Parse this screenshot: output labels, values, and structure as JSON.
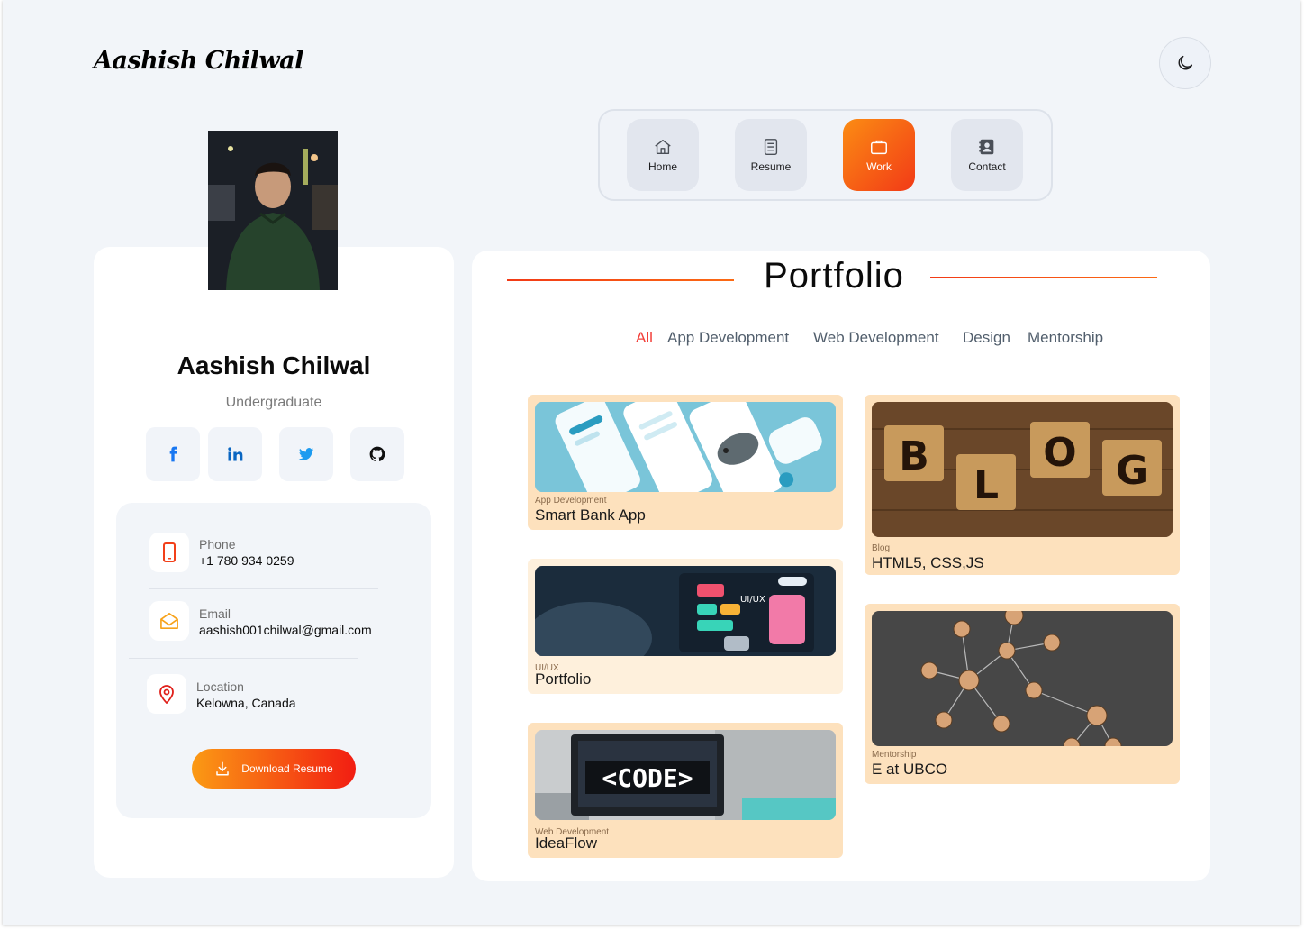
{
  "header": {
    "logo": "Aashish Chilwal",
    "theme_icon": "moon-icon"
  },
  "nav": {
    "items": [
      {
        "label": "Home",
        "icon": "home-icon"
      },
      {
        "label": "Resume",
        "icon": "document-icon"
      },
      {
        "label": "Work",
        "icon": "briefcase-icon",
        "active": true
      },
      {
        "label": "Contact",
        "icon": "contact-book-icon"
      }
    ]
  },
  "profile": {
    "name": "Aashish Chilwal",
    "role": "Undergraduate",
    "social": [
      "facebook-icon",
      "linkedin-icon",
      "twitter-icon",
      "github-icon"
    ],
    "phone": {
      "label": "Phone",
      "value": "+1 780 934 0259"
    },
    "email": {
      "label": "Email",
      "value": "aashish001chilwal@gmail.com"
    },
    "location": {
      "label": "Location",
      "value": "Kelowna, Canada"
    },
    "download_label": "Download Resume"
  },
  "portfolio": {
    "title": "Portfolio",
    "filters": [
      "All",
      "App Development",
      "Web Development",
      "Design",
      "Mentorship"
    ],
    "active_filter": "All",
    "cards": [
      {
        "category": "App Development",
        "title": "Smart Bank App"
      },
      {
        "category": "UI/UX",
        "title": "Portfolio"
      },
      {
        "category": "Web Development",
        "title": "IdeaFlow"
      },
      {
        "category": "Blog",
        "title": "HTML5, CSS,JS"
      },
      {
        "category": "Mentorship",
        "title": "E at UBCO"
      }
    ],
    "thumb_texts": {
      "code": "<CODE>",
      "blog": [
        "B",
        "L",
        "O",
        "G"
      ],
      "uiux": "UI/UX"
    }
  },
  "colors": {
    "accent_start": "#fb8c14",
    "accent_end": "#f23a16",
    "card_bg": "#fde1bd",
    "page_bg": "#f2f5f9"
  }
}
